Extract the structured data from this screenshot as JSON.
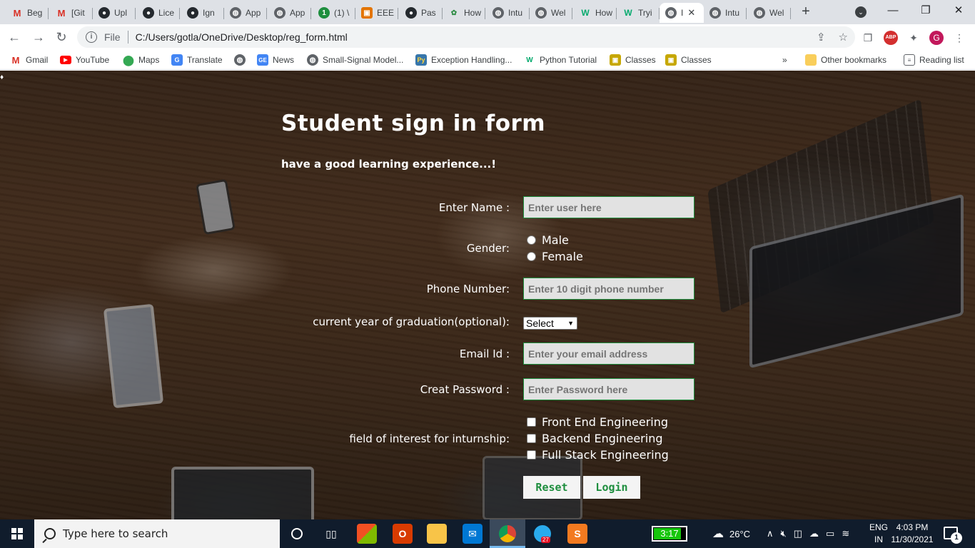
{
  "browser": {
    "tabs": [
      {
        "label": "Beg",
        "icon": "gmail-icon"
      },
      {
        "label": "[Git",
        "icon": "gmail-icon"
      },
      {
        "label": "Upl",
        "icon": "github-icon"
      },
      {
        "label": "Lice",
        "icon": "github-icon"
      },
      {
        "label": "Ign",
        "icon": "github-icon"
      },
      {
        "label": "App",
        "icon": "globe-icon"
      },
      {
        "label": "App",
        "icon": "globe-icon"
      },
      {
        "label": "(1) \\",
        "icon": "green-badge-icon"
      },
      {
        "label": "EEE",
        "icon": "orange-app-icon"
      },
      {
        "label": "Pas",
        "icon": "github-icon"
      },
      {
        "label": "How",
        "icon": "leaf-icon"
      },
      {
        "label": "Intu",
        "icon": "globe-icon"
      },
      {
        "label": "Wel",
        "icon": "globe-icon"
      },
      {
        "label": "How",
        "icon": "w3-icon"
      },
      {
        "label": "Tryi",
        "icon": "w3-icon"
      },
      {
        "label": "I",
        "icon": "globe-icon",
        "active": true
      },
      {
        "label": "Intu",
        "icon": "globe-icon"
      },
      {
        "label": "Wel",
        "icon": "globe-icon"
      }
    ],
    "new_tab": "+",
    "window_controls": {
      "minimize": "—",
      "maximize": "❐",
      "close": "✕"
    },
    "address": {
      "scheme_label": "File",
      "url": "C:/Users/gotla/OneDrive/Desktop/reg_form.html"
    },
    "bookmarks": [
      {
        "label": "Gmail",
        "icon": "gmail-icon"
      },
      {
        "label": "YouTube",
        "icon": "youtube-icon"
      },
      {
        "label": "Maps",
        "icon": "maps-icon"
      },
      {
        "label": "Translate",
        "icon": "translate-icon"
      },
      {
        "label": "",
        "icon": "globe-icon"
      },
      {
        "label": "News",
        "icon": "news-icon"
      },
      {
        "label": "Small-Signal Model...",
        "icon": "globe-icon"
      },
      {
        "label": "Exception Handling...",
        "icon": "python-icon"
      },
      {
        "label": "Python Tutorial",
        "icon": "w3-icon"
      },
      {
        "label": "Classes",
        "icon": "classroom-icon"
      },
      {
        "label": "Classes",
        "icon": "classroom-icon"
      }
    ],
    "bookmarks_overflow": "»",
    "other_bookmarks": "Other bookmarks",
    "reading_list": "Reading list",
    "profile_initial": "G",
    "abp_label": "ABP"
  },
  "form": {
    "title": "Student sign in form",
    "subtitle": "have a good learning experience...!",
    "name_label": "Enter Name :",
    "name_placeholder": "Enter user here",
    "gender_label": "Gender:",
    "gender_options": [
      "Male",
      "Female"
    ],
    "phone_label": "Phone Number:",
    "phone_placeholder": "Enter 10 digit phone number",
    "year_label": "current year of graduation(optional):",
    "year_selected": "Select",
    "email_label": "Email Id :",
    "email_placeholder": "Enter your email address",
    "password_label": "Creat Password :",
    "password_placeholder": "Enter Password here",
    "interest_label": "field of interest for inturnship:",
    "interest_options": [
      "Front End Engineering",
      "Backend Engineering",
      "Full Stack Engineering"
    ],
    "reset_label": "Reset",
    "login_label": "Login"
  },
  "taskbar": {
    "search_placeholder": "Type here to search",
    "battery_text": "3:17",
    "weather": "26°C",
    "language_line1": "ENG",
    "language_line2": "IN",
    "time": "4:03 PM",
    "date": "11/30/2021",
    "notification_count": "1",
    "telegram_badge": "27"
  }
}
